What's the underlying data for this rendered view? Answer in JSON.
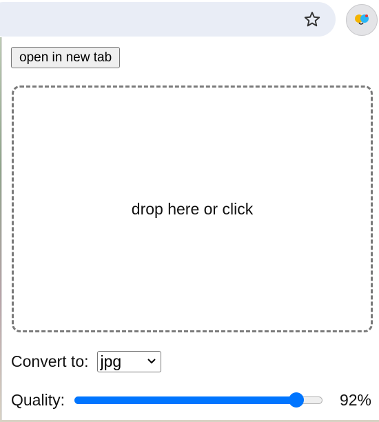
{
  "toolbar": {
    "bookmark_icon": "star-outline-icon",
    "extension_icon": "extension-avatar-icon"
  },
  "popup": {
    "open_in_new_tab_label": "open in new tab",
    "dropzone_text": "drop here or click",
    "convert_label": "Convert to:",
    "format_selected": "jpg",
    "quality_label": "Quality:",
    "quality_value": "92%",
    "quality_fraction": 0.92
  },
  "colors": {
    "accent": "#0075ff",
    "omnibox": "#e9edf6",
    "dashed_border": "#7a7a7a"
  }
}
